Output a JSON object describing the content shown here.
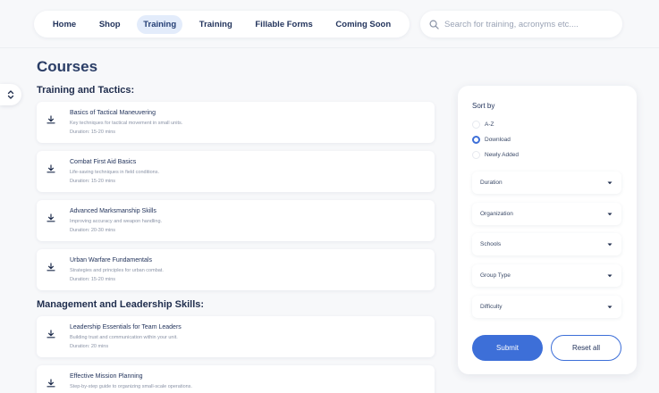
{
  "nav": {
    "items": [
      {
        "label": "Home",
        "active": false
      },
      {
        "label": "Shop",
        "active": false
      },
      {
        "label": "Training",
        "active": true
      },
      {
        "label": "Training",
        "active": false
      },
      {
        "label": "Fillable Forms",
        "active": false
      },
      {
        "label": "Coming Soon",
        "active": false
      }
    ]
  },
  "search": {
    "placeholder": "Search for training, acronyms etc....",
    "value": "",
    "icon": "search-icon"
  },
  "side_handle": {
    "icon": "chevron-up-down-icon"
  },
  "page": {
    "title": "Courses"
  },
  "sections": [
    {
      "title": "Training and Tactics:",
      "courses": [
        {
          "title": "Basics of Tactical Maneuvering",
          "description": "Key techniques for tactical movement in small units.",
          "duration": "Duration: 15-20 mins"
        },
        {
          "title": "Combat First Aid Basics",
          "description": "Life-saving techniques in field conditions.",
          "duration": "Duration: 15-20 mins"
        },
        {
          "title": "Advanced Marksmanship Skills",
          "description": "Improving accuracy and weapon handling.",
          "duration": "Duration: 20-30 mins"
        },
        {
          "title": "Urban Warfare Fundamentals",
          "description": "Strategies and principles for urban combat.",
          "duration": "Duration: 15-20 mins"
        }
      ]
    },
    {
      "title": "Management and Leadership Skills:",
      "courses": [
        {
          "title": "Leadership Essentials for Team Leaders",
          "description": "Building trust and communication within your unit.",
          "duration": "Duration: 20 mins"
        },
        {
          "title": "Effective Mission Planning",
          "description": "Step-by-step guide to organizing small-scale operations.",
          "duration": ""
        }
      ]
    }
  ],
  "filters": {
    "sort_label": "Sort by",
    "sort_options": [
      {
        "label": "A-Z",
        "selected": false
      },
      {
        "label": "Download",
        "selected": true
      },
      {
        "label": "Newly Added",
        "selected": false
      }
    ],
    "dropdowns": [
      "Duration",
      "Organization",
      "Schools",
      "Group Type",
      "Difficulty"
    ],
    "submit_label": "Submit",
    "reset_label": "Reset all"
  },
  "colors": {
    "accent": "#3d6fd8",
    "text_dark": "#1f2d4d",
    "active_tab_bg": "#e3ecfb",
    "background": "#f7f8fa"
  }
}
